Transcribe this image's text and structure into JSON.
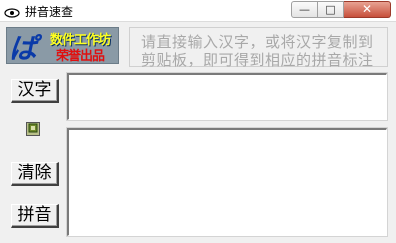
{
  "window": {
    "title": "拼音速查",
    "icon": "app-eye-icon",
    "controls": {
      "minimize": "—",
      "maximize": "□",
      "close": "✕"
    }
  },
  "logo": {
    "mark": "ぱ",
    "line1": "数件工作坊",
    "line2": "荣誉出品"
  },
  "hint": {
    "line1": "请直接输入汉字，或将汉字复制到",
    "line2": "剪贴板，即可得到相应的拼音标注"
  },
  "buttons": {
    "hanzi": "汉字",
    "clear": "清除",
    "pinyin": "拼音",
    "mini_icon": "small-paste-icon"
  },
  "inputs": {
    "hanzi_value": "",
    "result_value": ""
  },
  "colors": {
    "hint_text": "#a8a8a8",
    "logo_yellow": "#ffff20",
    "logo_red": "#e01010",
    "logo_blue": "#0a3aa8"
  }
}
